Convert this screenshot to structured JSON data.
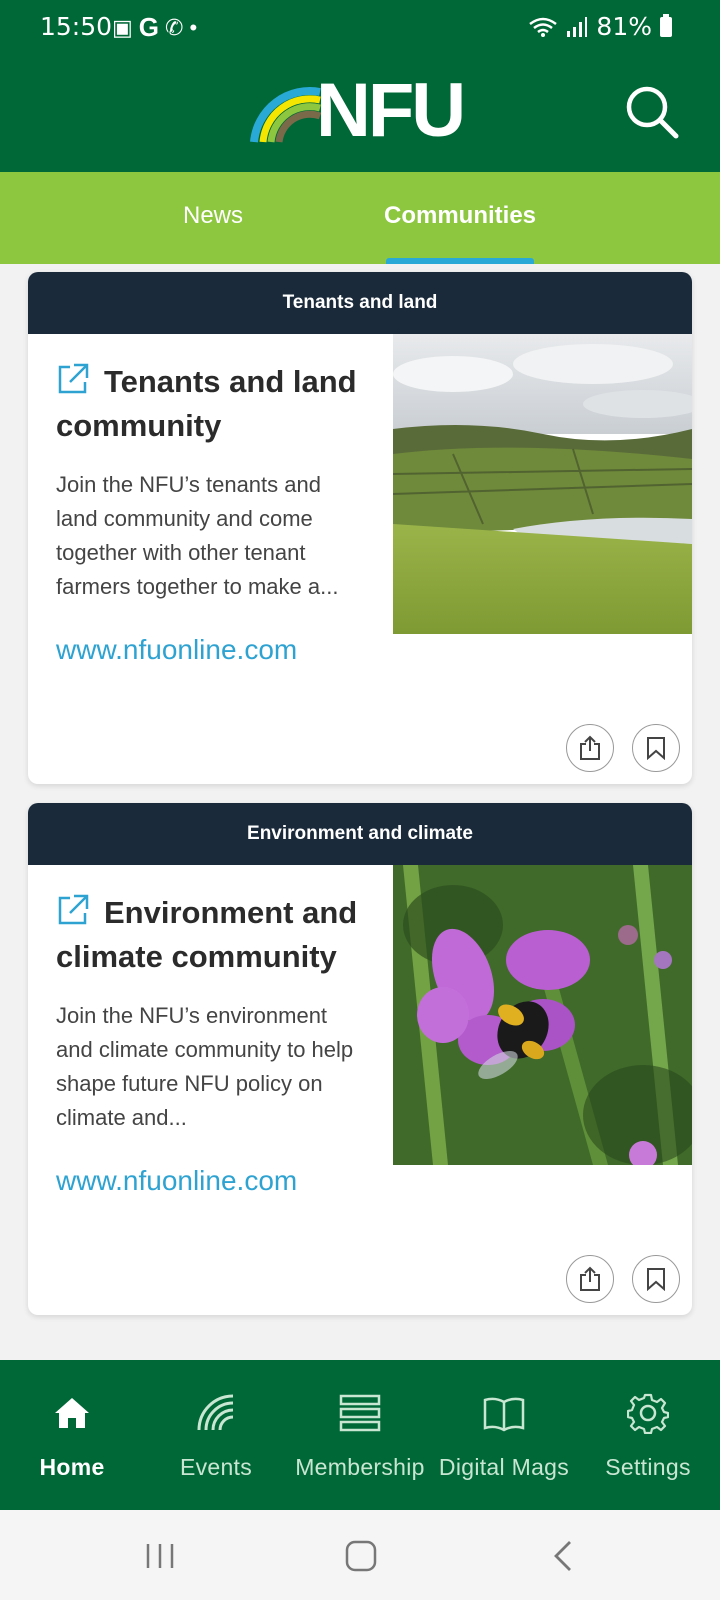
{
  "status_bar": {
    "time": "15:50",
    "battery": "81%"
  },
  "header": {
    "logo_text": "NFU"
  },
  "tabs": [
    {
      "label": "News",
      "active": false
    },
    {
      "label": "Communities",
      "active": true
    }
  ],
  "cards": [
    {
      "category": "Tenants and land",
      "title": "Tenants and land community",
      "description": "Join the NFU’s tenants and land community and come together with other tenant farmers together to make a...",
      "link": "www.nfuonline.com",
      "image_icon": "landscape-photo"
    },
    {
      "category": "Environment and climate",
      "title": "Environment and climate community",
      "description": "Join the NFU’s environment and climate community to help shape future NFU policy on climate and...",
      "link": "www.nfuonline.com",
      "image_icon": "bee-on-flower-photo"
    }
  ],
  "bottom_nav": [
    {
      "label": "Home",
      "icon": "home-icon",
      "active": true
    },
    {
      "label": "Events",
      "icon": "events-icon",
      "active": false
    },
    {
      "label": "Membership",
      "icon": "membership-icon",
      "active": false
    },
    {
      "label": "Digital Mags",
      "icon": "book-icon",
      "active": false
    },
    {
      "label": "Settings",
      "icon": "gear-icon",
      "active": false
    }
  ],
  "colors": {
    "primary_green": "#006837",
    "light_green": "#8dc63f",
    "card_header": "#1a2a3a",
    "link_blue": "#2ea3d2",
    "tab_indicator": "#29a9d6"
  }
}
